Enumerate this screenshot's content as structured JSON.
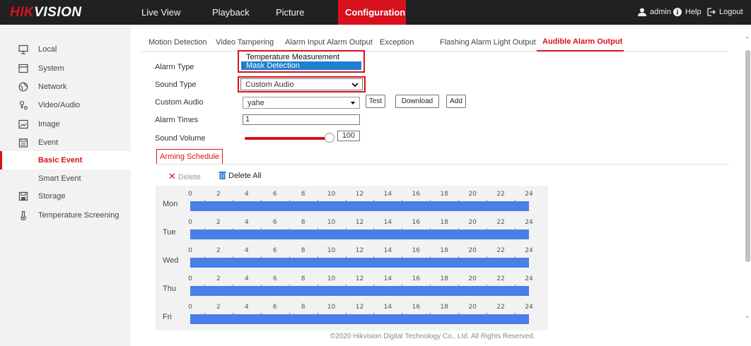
{
  "brand": {
    "part1": "HIK",
    "part2": "VISION"
  },
  "top_nav": [
    "Live View",
    "Playback",
    "Picture",
    "Configuration"
  ],
  "user": {
    "name": "admin",
    "help": "Help",
    "logout": "Logout"
  },
  "sidebar": {
    "items": [
      "Local",
      "System",
      "Network",
      "Video/Audio",
      "Image",
      "Event"
    ],
    "sub_items": [
      "Basic Event",
      "Smart Event"
    ],
    "items_after": [
      "Storage",
      "Temperature Screening"
    ]
  },
  "tabs": [
    "Motion Detection",
    "Video Tampering",
    "Alarm Input",
    "Alarm Output",
    "Exception",
    "Flashing Alarm Light Output",
    "Audible Alarm Output"
  ],
  "form": {
    "alarm_type_label": "Alarm Type",
    "alarm_type_options": [
      "Temperature Measurement",
      "Mask Detection"
    ],
    "sound_type_label": "Sound Type",
    "sound_type_value": "Custom Audio",
    "custom_audio_label": "Custom Audio",
    "custom_audio_value": "yahe",
    "test_button": "Test",
    "download_button": "Download",
    "add_button": "Add",
    "alarm_times_label": "Alarm Times",
    "alarm_times_value": "1",
    "sound_volume_label": "Sound Volume",
    "sound_volume_value": "100"
  },
  "arming": {
    "tab": "Arming Schedule",
    "delete": "Delete",
    "delete_all": "Delete All",
    "days": [
      "Mon",
      "Tue",
      "Wed",
      "Thu",
      "Fri"
    ],
    "hours": [
      "0",
      "2",
      "4",
      "6",
      "8",
      "10",
      "12",
      "14",
      "16",
      "18",
      "20",
      "22",
      "24"
    ]
  },
  "footer": "©2020 Hikvision Digital Technology Co., Ltd. All Rights Reserved.",
  "colors": {
    "accent": "#d7111d",
    "schedule_bar": "#4a7ee8",
    "topbar": "#212121"
  }
}
